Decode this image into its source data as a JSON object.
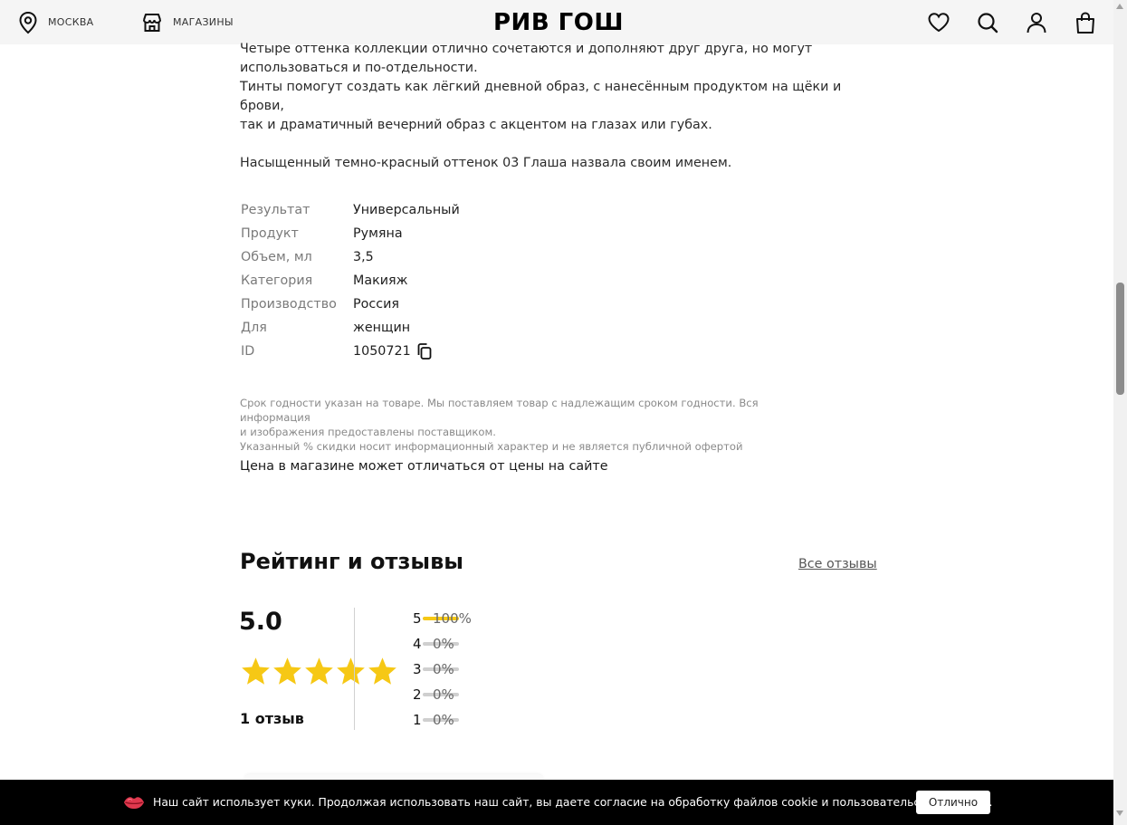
{
  "header": {
    "location_label": "МОСКВА",
    "location_icon": "location-pin-icon",
    "stores_label": "МАГАЗИНЫ",
    "stores_icon": "store-icon",
    "logo": "РИВ ГОШ",
    "icons": [
      "heart-icon",
      "search-icon",
      "user-icon",
      "bag-icon"
    ]
  },
  "description": {
    "lines": [
      "Четыре оттенка коллекции отлично сочетаются и дополняют друг друга, но могут",
      "использоваться и по-отдельности.",
      "Тинты помогут создать как лёгкий дневной образ, с нанесённым продуктом на щёки и брови,",
      "так и драматичный вечерний образ с акцентом на глазах или губах.",
      "Насыщенный темно-красный оттенок 03 Глаша назвала своим именем."
    ]
  },
  "specs": [
    {
      "key": "Результат",
      "value": "Универсальный"
    },
    {
      "key": "Продукт",
      "value": "Румяна"
    },
    {
      "key": "Объем, мл",
      "value": "3,5"
    },
    {
      "key": "Категория",
      "value": "Макияж"
    },
    {
      "key": "Производство",
      "value": "Россия"
    },
    {
      "key": "Для",
      "value": "женщин"
    },
    {
      "key": "ID",
      "value": "1050721"
    }
  ],
  "notes": {
    "line1": "Срок годности указан на товаре. Мы поставляем товар с надлежащим сроком годности. Вся информация",
    "line2": "и изображения предоставлены поставщиком.",
    "line3": "Указанный % скидки носит информационный характер и не является публичной офертой",
    "price_note": "Цена в магазине может отличаться от цены на сайте"
  },
  "reviews": {
    "title": "Рейтинг и отзывы",
    "all_link": "Все отзывы",
    "average": "5.0",
    "stars": 5,
    "count_label": "1 отзыв",
    "distribution": [
      {
        "star": "5",
        "pct": "100%",
        "fraction": 1.0
      },
      {
        "star": "4",
        "pct": "0%",
        "fraction": 0.0
      },
      {
        "star": "3",
        "pct": "0%",
        "fraction": 0.0
      },
      {
        "star": "2",
        "pct": "0%",
        "fraction": 0.0
      },
      {
        "star": "1",
        "pct": "0%",
        "fraction": 0.0
      }
    ],
    "star_color": "#f6c815"
  },
  "cookie": {
    "text": "Наш сайт использует куки. Продолжая использовать наш сайт, вы даете согласие на обработку файлов cookie и пользовательских данных.",
    "button": "Отлично",
    "icon": "lips-icon"
  }
}
